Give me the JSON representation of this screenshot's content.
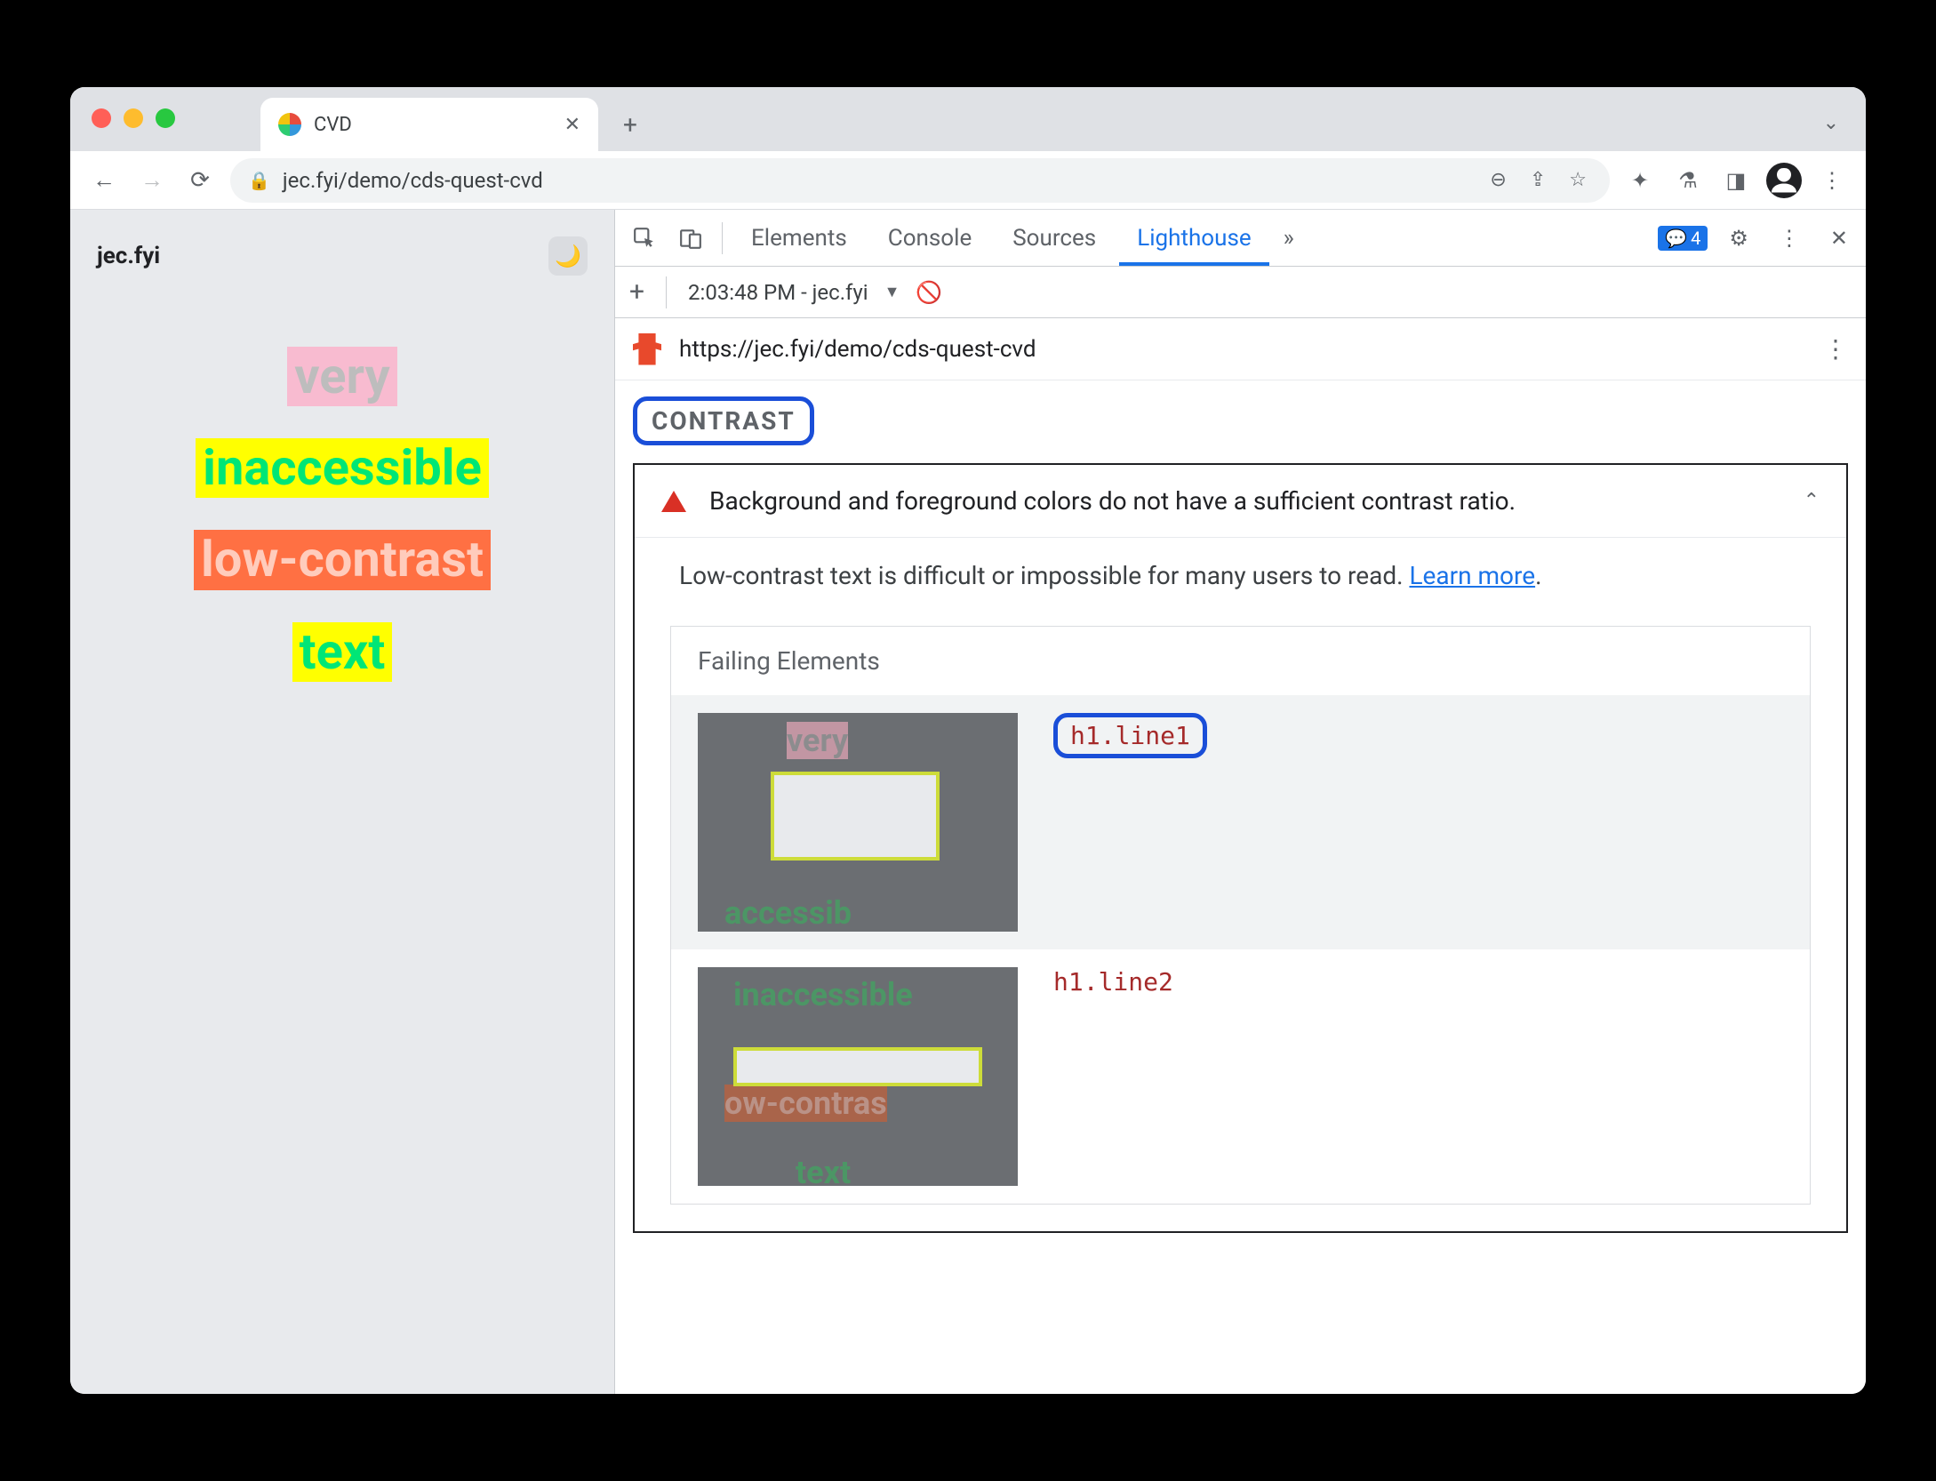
{
  "browser": {
    "tab_title": "CVD",
    "url": "jec.fyi/demo/cds-quest-cvd"
  },
  "page": {
    "site_title": "jec.fyi",
    "lines": [
      "very",
      "inaccessible",
      "low-contrast",
      "text"
    ]
  },
  "devtools": {
    "tabs": [
      "Elements",
      "Console",
      "Sources",
      "Lighthouse"
    ],
    "active_tab": "Lighthouse",
    "more_indicator": "»",
    "feedback_count": "4",
    "snapshot_label": "2:03:48 PM - jec.fyi",
    "report_url": "https://jec.fyi/demo/cds-quest-cvd",
    "section_label": "CONTRAST",
    "audit": {
      "title": "Background and foreground colors do not have a sufficient contrast ratio.",
      "description_pre": "Low-contrast text is difficult or impossible for many users to read. ",
      "learn_more": "Learn more",
      "description_post": ".",
      "failing_label": "Failing Elements",
      "items": [
        "h1.line1",
        "h1.line2"
      ]
    }
  }
}
